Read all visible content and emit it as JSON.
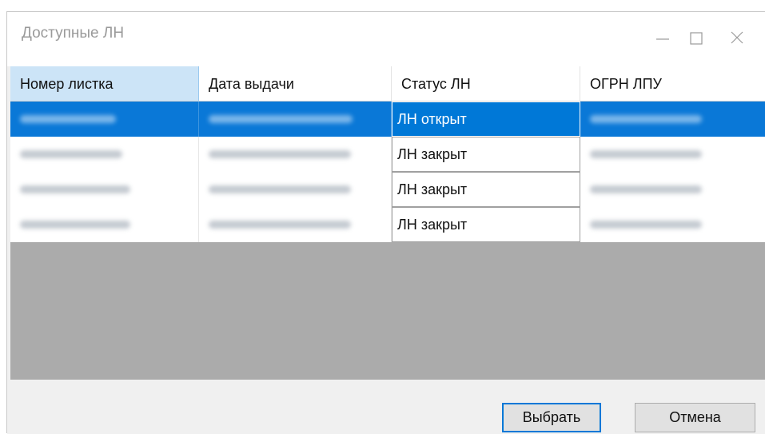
{
  "window": {
    "title": "Доступные ЛН",
    "controls": [
      "minimize-icon",
      "maximize-icon",
      "close-icon"
    ]
  },
  "grid": {
    "columns": [
      "Номер листка",
      "Дата выдачи",
      "Статус ЛН",
      "ОГРН ЛПУ"
    ],
    "rows": [
      {
        "status": "ЛН открыт",
        "selected": true
      },
      {
        "status": "ЛН закрыт",
        "selected": false
      },
      {
        "status": "ЛН закрыт",
        "selected": false
      },
      {
        "status": "ЛН закрыт",
        "selected": false
      }
    ]
  },
  "buttons": {
    "select_label": "Выбрать",
    "cancel_label": "Отмена"
  },
  "colors": {
    "selection": "#0078d7",
    "header_selected": "#cce4f7",
    "empty_area": "#ababab"
  }
}
